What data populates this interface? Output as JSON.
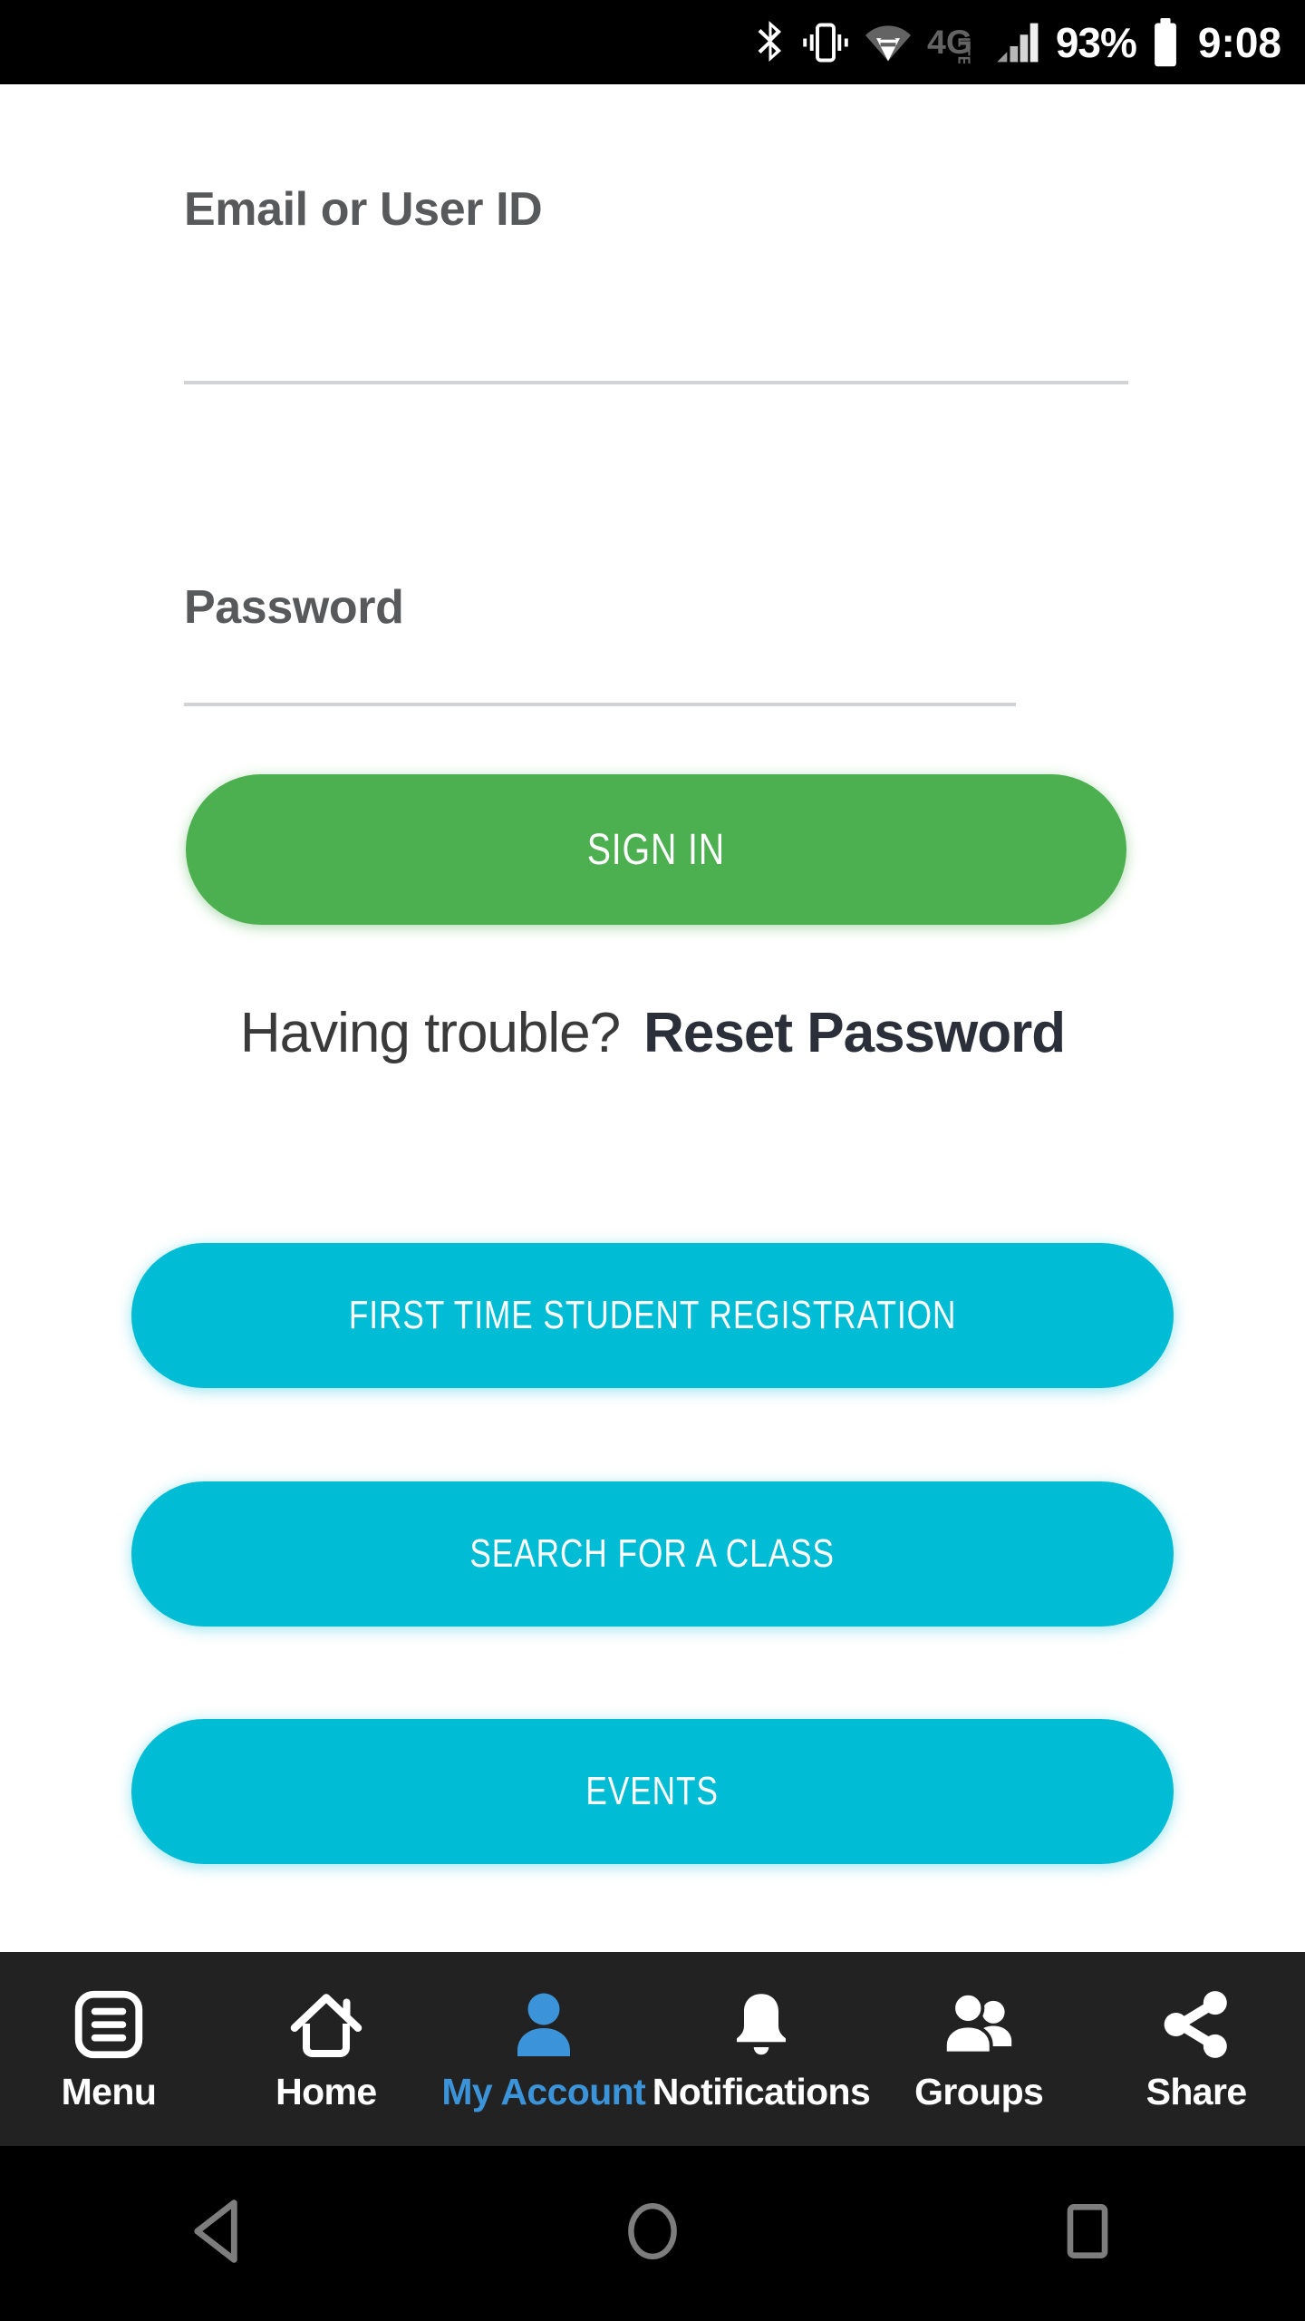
{
  "status_bar": {
    "icons": [
      "bluetooth-icon",
      "vibrate-icon",
      "wifi-icon",
      "4glte-icon",
      "signal-bars-icon",
      "battery-icon"
    ],
    "network_label": "4G",
    "network_sub": "LTE",
    "battery_percent": "93%",
    "clock": "9:08",
    "background_color": "#000000"
  },
  "form": {
    "email": {
      "label": "Email or User ID",
      "value": "",
      "placeholder": ""
    },
    "password": {
      "label": "Password",
      "value": "",
      "placeholder": ""
    },
    "sign_in_label": "SIGN IN",
    "sign_in_color": "#4CAF50"
  },
  "help": {
    "trouble_text": "Having trouble?",
    "reset_link": "Reset Password"
  },
  "actions": {
    "color": "#00BCD4",
    "buttons": [
      {
        "label": "FIRST TIME STUDENT REGISTRATION",
        "name": "registration-button"
      },
      {
        "label": "SEARCH FOR A CLASS",
        "name": "search-class-button"
      },
      {
        "label": "EVENTS",
        "name": "events-button"
      }
    ]
  },
  "tab_bar": {
    "background_color": "#222222",
    "active_color": "#3B93D9",
    "active_index": 2,
    "items": [
      {
        "label": "Menu",
        "icon": "menu-list-icon"
      },
      {
        "label": "Home",
        "icon": "home-icon"
      },
      {
        "label": "My Account",
        "icon": "person-icon"
      },
      {
        "label": "Notifications",
        "icon": "bell-icon"
      },
      {
        "label": "Groups",
        "icon": "people-group-icon"
      },
      {
        "label": "Share",
        "icon": "share-icon"
      }
    ]
  },
  "nav_bar": {
    "background_color": "#000000",
    "buttons": [
      {
        "name": "back-button",
        "icon": "back-triangle-icon"
      },
      {
        "name": "home-button",
        "icon": "home-circle-icon"
      },
      {
        "name": "recents-button",
        "icon": "recents-square-icon"
      }
    ]
  }
}
